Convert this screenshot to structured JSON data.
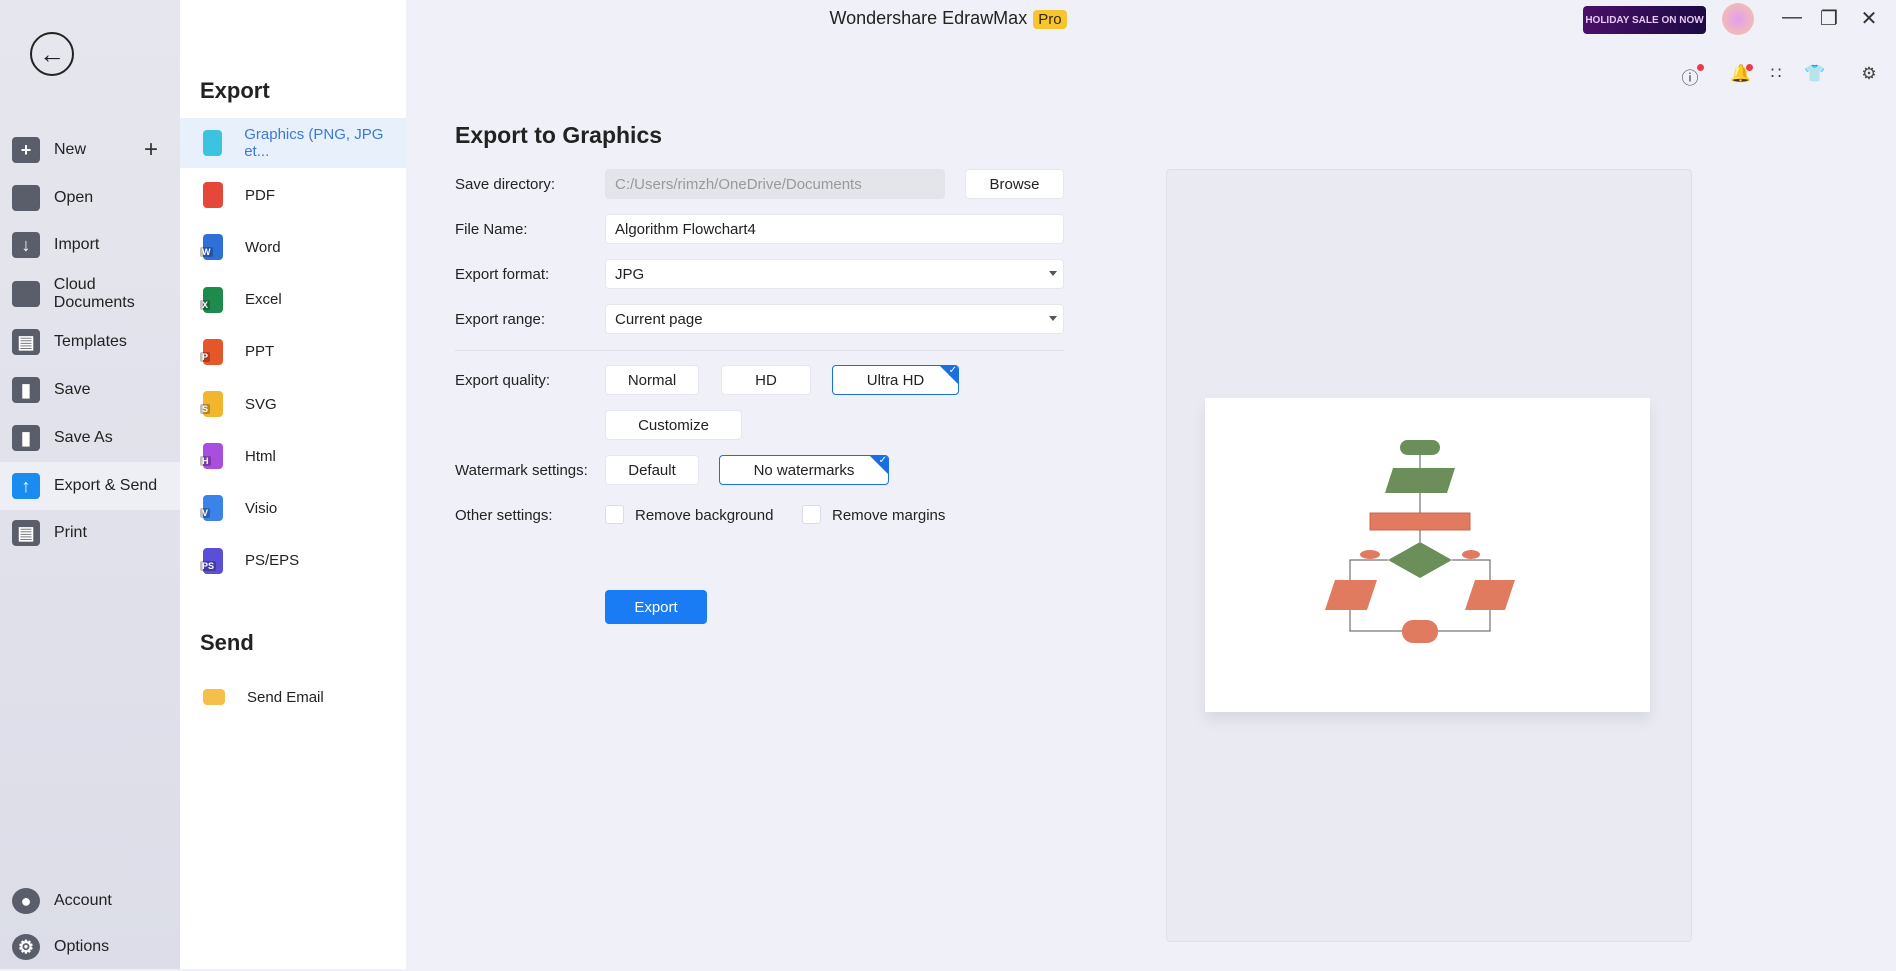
{
  "app": {
    "title": "Wondershare EdrawMax",
    "badge": "Pro",
    "promo": "HOLIDAY SALE ON NOW"
  },
  "sidebar": {
    "items": [
      {
        "label": "New",
        "icon": "plus-square-icon"
      },
      {
        "label": "Open",
        "icon": "folder-icon"
      },
      {
        "label": "Import",
        "icon": "import-icon"
      },
      {
        "label": "Cloud Documents",
        "icon": "cloud-icon"
      },
      {
        "label": "Templates",
        "icon": "templates-icon"
      },
      {
        "label": "Save",
        "icon": "save-icon"
      },
      {
        "label": "Save As",
        "icon": "save-as-icon"
      },
      {
        "label": "Export & Send",
        "icon": "export-icon",
        "selected": true
      },
      {
        "label": "Print",
        "icon": "print-icon"
      }
    ],
    "bottom": [
      {
        "label": "Account",
        "icon": "account-icon"
      },
      {
        "label": "Options",
        "icon": "gear-icon"
      }
    ]
  },
  "panel": {
    "export_heading": "Export",
    "send_heading": "Send",
    "export_items": [
      {
        "label": "Graphics (PNG, JPG et...",
        "letter": "",
        "color": "#3cc3e0",
        "selected": true
      },
      {
        "label": "PDF",
        "letter": "",
        "color": "#e5483a"
      },
      {
        "label": "Word",
        "letter": "W",
        "color": "#2f6fd8"
      },
      {
        "label": "Excel",
        "letter": "X",
        "color": "#1e8a4c"
      },
      {
        "label": "PPT",
        "letter": "P",
        "color": "#e5562a"
      },
      {
        "label": "SVG",
        "letter": "S",
        "color": "#f2b52e"
      },
      {
        "label": "Html",
        "letter": "H",
        "color": "#a84fe0"
      },
      {
        "label": "Visio",
        "letter": "V",
        "color": "#3a83e8"
      },
      {
        "label": "PS/EPS",
        "letter": "PS",
        "color": "#5b4fd8"
      }
    ],
    "send_items": [
      {
        "label": "Send Email",
        "color": "#f5c04a"
      }
    ]
  },
  "form": {
    "heading": "Export to Graphics",
    "save_directory": {
      "label": "Save directory:",
      "value": "C:/Users/rimzh/OneDrive/Documents",
      "browse": "Browse"
    },
    "file_name": {
      "label": "File Name:",
      "value": "Algorithm Flowchart4"
    },
    "export_format": {
      "label": "Export format:",
      "value": "JPG"
    },
    "export_range": {
      "label": "Export range:",
      "value": "Current page"
    },
    "quality": {
      "label": "Export quality:",
      "options": [
        "Normal",
        "HD",
        "Ultra HD"
      ],
      "selected": "Ultra HD",
      "customize": "Customize"
    },
    "watermark": {
      "label": "Watermark settings:",
      "options": [
        "Default",
        "No watermarks"
      ],
      "selected": "No watermarks"
    },
    "other": {
      "label": "Other settings:",
      "remove_background": "Remove background",
      "remove_margins": "Remove margins",
      "remove_background_checked": false,
      "remove_margins_checked": false
    },
    "export_button": "Export"
  },
  "colors": {
    "accent": "#1a7cf5",
    "flow_green": "#6b8e5a",
    "flow_orange": "#e07b5f"
  }
}
